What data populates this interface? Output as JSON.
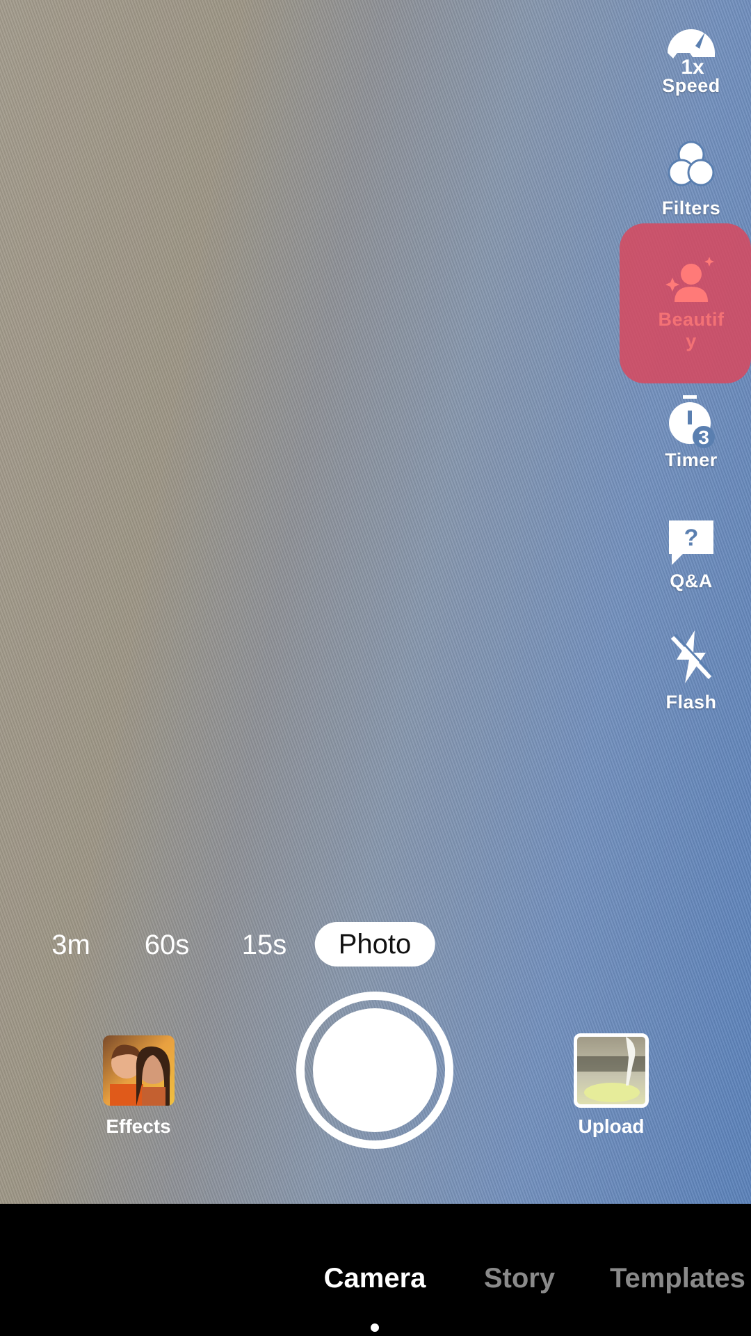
{
  "right_rail": [
    {
      "label": "Speed",
      "icon": "speed-gauge-icon",
      "badge": "1x"
    },
    {
      "label": "Filters",
      "icon": "filters-icon"
    },
    {
      "label_line1": "Beautif",
      "label_line2": "y",
      "icon": "beautify-icon",
      "highlighted": true
    },
    {
      "label": "Timer",
      "icon": "timer-icon",
      "badge": "3"
    },
    {
      "label": "Q&A",
      "icon": "qa-icon",
      "badge": "?"
    },
    {
      "label": "Flash",
      "icon": "flash-off-icon"
    }
  ],
  "modes": [
    "3m",
    "60s",
    "15s",
    "Photo"
  ],
  "selected_mode": "Photo",
  "effects_label": "Effects",
  "upload_label": "Upload",
  "bottom_tabs": [
    "Camera",
    "Story",
    "Templates"
  ],
  "selected_tab": "Camera",
  "colors": {
    "highlight": "#dc465a",
    "beautify_icon": "#ff7a78",
    "inactive_tab": "#8a8a8a"
  }
}
